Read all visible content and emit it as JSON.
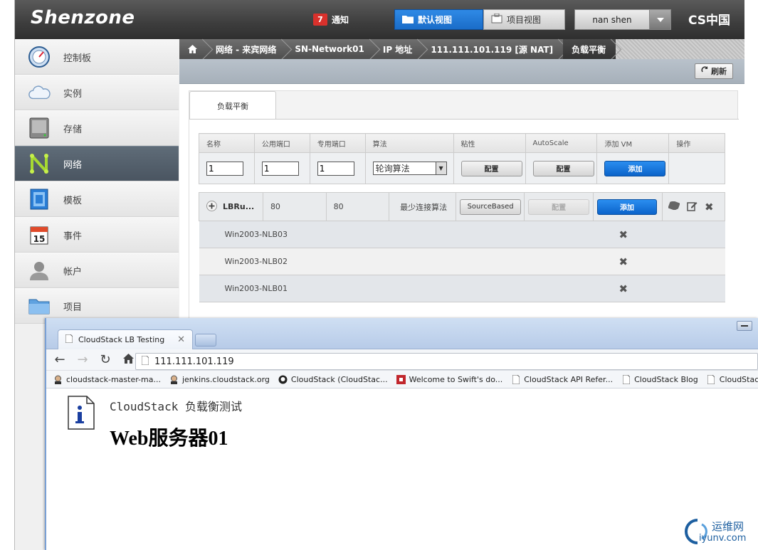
{
  "app": {
    "logo": "Shenzone",
    "brand": "CS中国",
    "notifications": {
      "count": "7",
      "label": "通知"
    },
    "views": [
      {
        "label": "默认视图",
        "active": true
      },
      {
        "label": "项目视图",
        "active": false
      }
    ],
    "user": "nan shen"
  },
  "sidebar": {
    "items": [
      {
        "label": "控制板",
        "icon": "dashboard-icon"
      },
      {
        "label": "实例",
        "icon": "cloud-icon"
      },
      {
        "label": "存储",
        "icon": "storage-icon"
      },
      {
        "label": "网络",
        "icon": "network-icon",
        "active": true
      },
      {
        "label": "模板",
        "icon": "template-icon"
      },
      {
        "label": "事件",
        "icon": "calendar-icon",
        "day": "15"
      },
      {
        "label": "帐户",
        "icon": "user-icon"
      },
      {
        "label": "项目",
        "icon": "folder-icon"
      }
    ]
  },
  "breadcrumb": {
    "items": [
      "网络 - 来宾网络",
      "SN-Network01",
      "IP 地址",
      "111.111.101.119 [源 NAT]",
      "负载平衡"
    ]
  },
  "toolbar": {
    "refresh_label": "刷新"
  },
  "tab": {
    "label": "负载平衡"
  },
  "form": {
    "headers": [
      "名称",
      "公用端口",
      "专用端口",
      "算法",
      "粘性",
      "AutoScale",
      "添加 VM",
      "操作"
    ],
    "name_value": "1",
    "public_port_value": "1",
    "private_port_value": "1",
    "algorithm_value": "轮询算法",
    "stickiness_button": "配置",
    "autoscale_button": "配置",
    "add_vm_button": "添加"
  },
  "rule": {
    "name": "LBRu...",
    "public_port": "80",
    "private_port": "80",
    "algorithm": "最少连接算法",
    "stickiness": "SourceBased",
    "autoscale_button": "配置",
    "add_vm_button": "添加",
    "vms": [
      "Win2003-NLB03",
      "Win2003-NLB02",
      "Win2003-NLB01"
    ]
  },
  "browser": {
    "tab_title": "CloudStack LB Testing",
    "url": "111.111.101.119",
    "bookmarks": [
      {
        "label": "cloudstack-master-ma...",
        "icon": "jenkins-icon"
      },
      {
        "label": "jenkins.cloudstack.org",
        "icon": "jenkins-icon"
      },
      {
        "label": "CloudStack (CloudStac...",
        "icon": "github-icon"
      },
      {
        "label": "Welcome to Swift's do...",
        "icon": "swift-icon"
      },
      {
        "label": "CloudStack API Refer...",
        "icon": "page-icon"
      },
      {
        "label": "CloudStack Blog",
        "icon": "page-icon"
      },
      {
        "label": "CloudStack Networkin...",
        "icon": "page-icon"
      }
    ],
    "page_title": "CloudStack 负载衡测试",
    "page_heading": "Web服务器01"
  },
  "watermark": {
    "top": "运维网",
    "bottom": "iyunv.com"
  }
}
